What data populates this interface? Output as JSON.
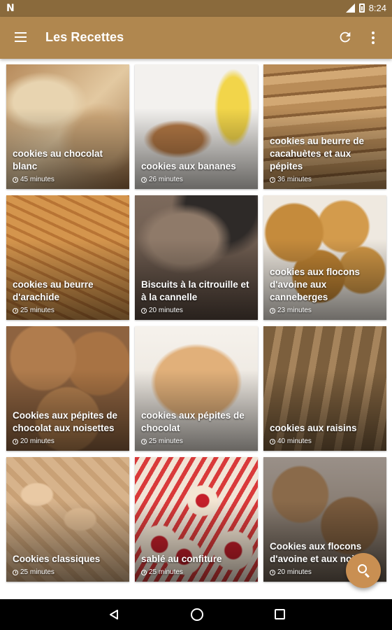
{
  "status_bar": {
    "time": "8:24",
    "left_icon_text": "N"
  },
  "app_bar": {
    "title": "Les Recettes"
  },
  "recipes": [
    {
      "name": "cookies au chocolat blanc",
      "time": "45 minutes"
    },
    {
      "name": "cookies aux bananes",
      "time": "26 minutes"
    },
    {
      "name": "cookies au beurre de cacahuètes et aux pépites",
      "time": "36 minutes"
    },
    {
      "name": "cookies au beurre d'arachide",
      "time": "25 minutes"
    },
    {
      "name": "Biscuits à la citrouille et à la cannelle",
      "time": "20 minutes"
    },
    {
      "name": "cookies aux flocons d'avoine aux canneberges",
      "time": "23 minutes"
    },
    {
      "name": "Cookies aux pépites de chocolat aux noisettes",
      "time": "20 minutes"
    },
    {
      "name": "cookies aux pépites de chocolat",
      "time": "25 minutes"
    },
    {
      "name": "cookies aux raisins",
      "time": "40 minutes"
    },
    {
      "name": "Cookies classiques",
      "time": "25 minutes"
    },
    {
      "name": "sablé au confiture",
      "time": "25 minutes"
    },
    {
      "name": "Cookies aux flocons d'avoine et aux noix",
      "time": "20 minutes"
    }
  ],
  "colors": {
    "app_bar": "#b0874f",
    "status_bar": "#8a6a3c",
    "fab": "#c98f52"
  },
  "icons": {
    "menu": "hamburger-menu-icon",
    "refresh": "refresh-icon",
    "more": "more-vert-icon",
    "fab": "search-icon",
    "clock": "clock-icon"
  }
}
